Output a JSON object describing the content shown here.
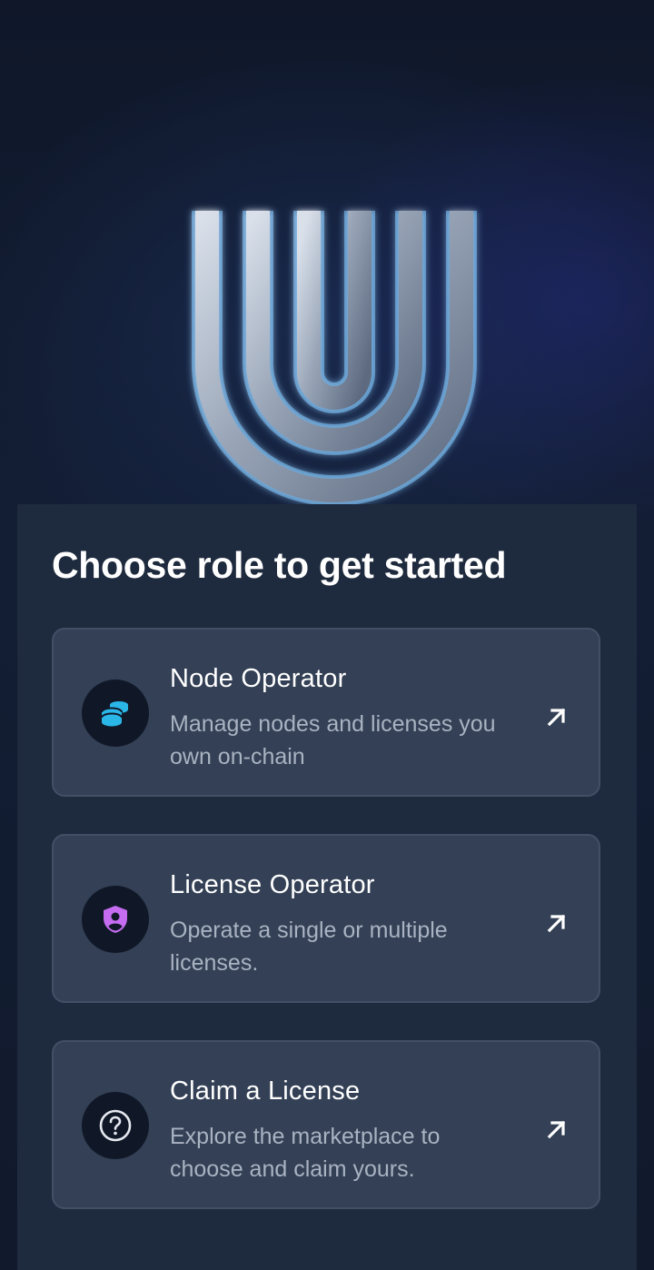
{
  "heading": "Choose role to get started",
  "roles": [
    {
      "title": "Node Operator",
      "description": "Manage nodes and licenses you own on-chain",
      "icon": "coin-stack-icon",
      "icon_color": "#2bb6e8"
    },
    {
      "title": "License Operator",
      "description": "Operate a single or multiple licenses.",
      "icon": "shield-user-icon",
      "icon_color": "#c56cf0"
    },
    {
      "title": "Claim a License",
      "description": "Explore the marketplace to choose and claim yours.",
      "icon": "question-circle-icon",
      "icon_color": "#e6e9ef"
    }
  ],
  "colors": {
    "sheet_background": "#1e2a3d",
    "card_background": "#334055",
    "text_primary": "#ffffff",
    "text_secondary": "#a9b3c2"
  }
}
